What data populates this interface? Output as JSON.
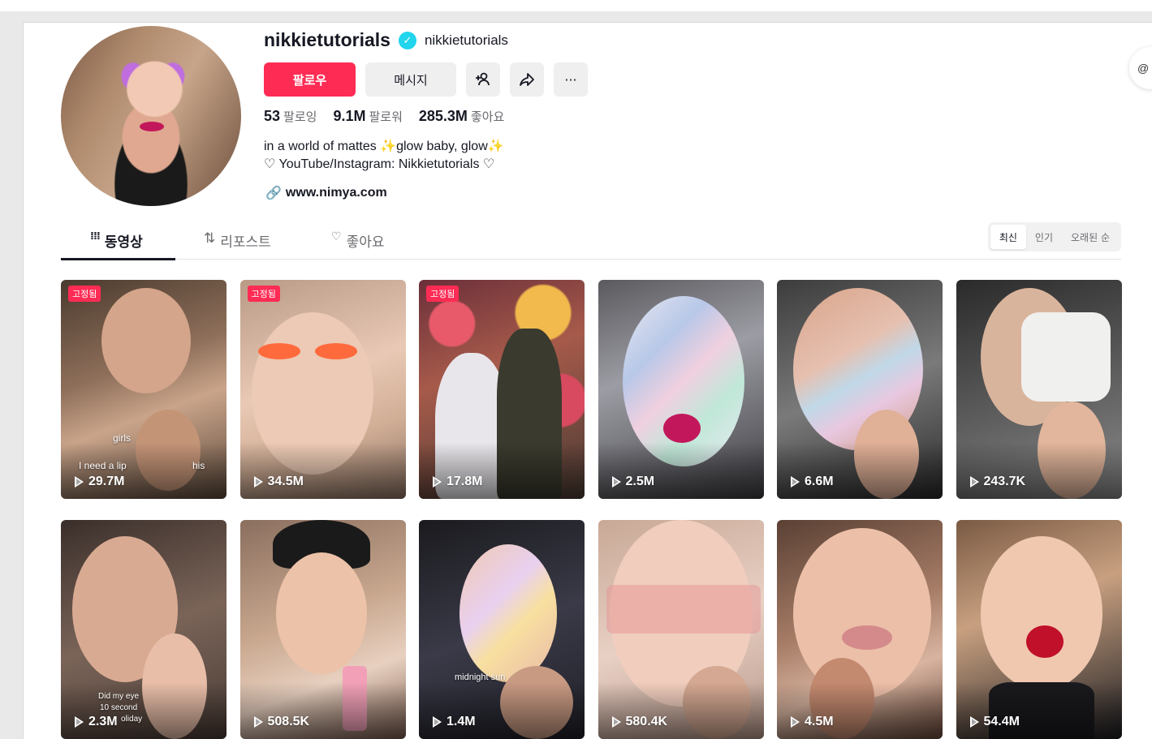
{
  "profile": {
    "username": "nikkietutorials",
    "nickname": "nikkietutorials",
    "follow_label": "팔로우",
    "message_label": "메시지",
    "more_label": "···",
    "stats": {
      "following_count": "53",
      "following_label": "팔로잉",
      "followers_count": "9.1M",
      "followers_label": "팔로워",
      "likes_count": "285.3M",
      "likes_label": "좋아요"
    },
    "bio_line1_a": "in a world of mattes ",
    "bio_line1_b": "glow baby, glow",
    "bio_line2": "♡ YouTube/Instagram: Nikkietutorials ♡",
    "link": "www.nimya.com"
  },
  "tabs": {
    "videos": "동영상",
    "reposts": "리포스트",
    "liked": "좋아요"
  },
  "sort": {
    "latest": "최신",
    "popular": "인기",
    "oldest": "오래된 순"
  },
  "pinned_label": "고정됨",
  "videos": [
    {
      "views": "29.7M",
      "pinned": true,
      "overlay1": "girls",
      "overlay2": "I need a lip",
      "overlay3": "his"
    },
    {
      "views": "34.5M",
      "pinned": true
    },
    {
      "views": "17.8M",
      "pinned": true
    },
    {
      "views": "2.5M"
    },
    {
      "views": "6.6M"
    },
    {
      "views": "243.7K"
    },
    {
      "views": "2.3M",
      "overlay1": "Did my eye",
      "overlay2": "10 second",
      "overlay3": "oliday"
    },
    {
      "views": "508.5K"
    },
    {
      "views": "1.4M",
      "overlay1": "midnight sun"
    },
    {
      "views": "580.4K"
    },
    {
      "views": "4.5M"
    },
    {
      "views": "54.4M"
    }
  ],
  "colors": {
    "accent": "#fe2c55",
    "verified": "#20d5ec"
  }
}
